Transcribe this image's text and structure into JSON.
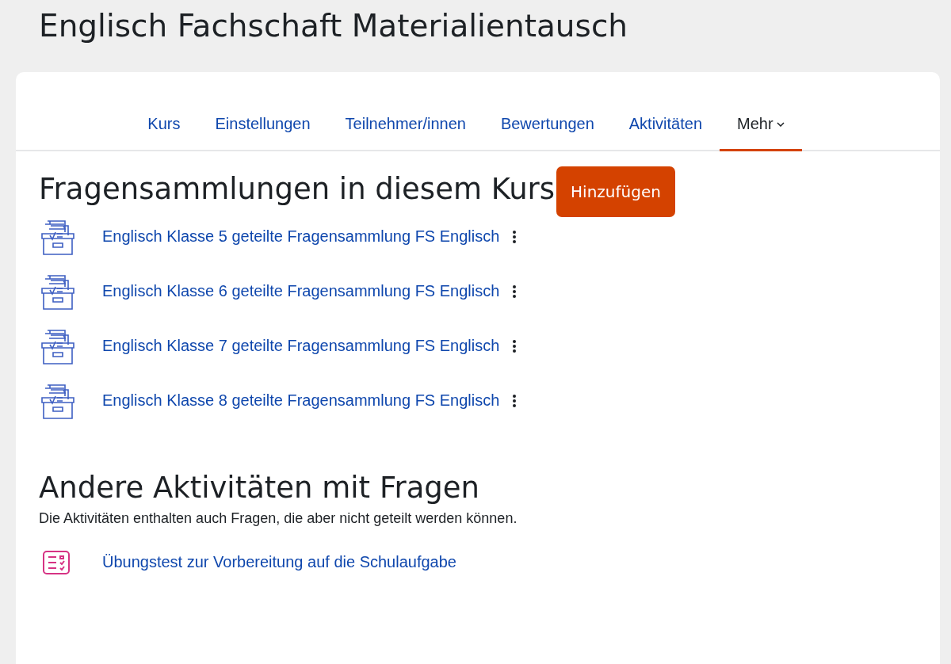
{
  "page_title": "Englisch Fachschaft Materialientausch",
  "tabs": [
    {
      "label": "Kurs",
      "selected": false,
      "dropdown": false
    },
    {
      "label": "Einstellungen",
      "selected": false,
      "dropdown": false
    },
    {
      "label": "Teilnehmer/innen",
      "selected": false,
      "dropdown": false
    },
    {
      "label": "Bewertungen",
      "selected": false,
      "dropdown": false
    },
    {
      "label": "Aktivitäten",
      "selected": false,
      "dropdown": false
    },
    {
      "label": "Mehr",
      "selected": true,
      "dropdown": true
    }
  ],
  "banks_section": {
    "heading": "Fragensammlungen in diesem Kurs",
    "add_button": "Hinzufügen",
    "items": [
      {
        "label": "Englisch Klasse 5 geteilte Fragensammlung FS Englisch"
      },
      {
        "label": "Englisch Klasse 6 geteilte Fragensammlung FS Englisch"
      },
      {
        "label": "Englisch Klasse 7 geteilte Fragensammlung FS Englisch"
      },
      {
        "label": "Englisch Klasse 8 geteilte Fragensammlung FS Englisch"
      }
    ]
  },
  "other_section": {
    "heading": "Andere Aktivitäten mit Fragen",
    "description": "Die Aktivitäten enthalten auch Fragen, die aber nicht geteilt werden können.",
    "items": [
      {
        "label": "Übungstest zur Vorbereitung auf die Schulaufgabe"
      }
    ]
  }
}
